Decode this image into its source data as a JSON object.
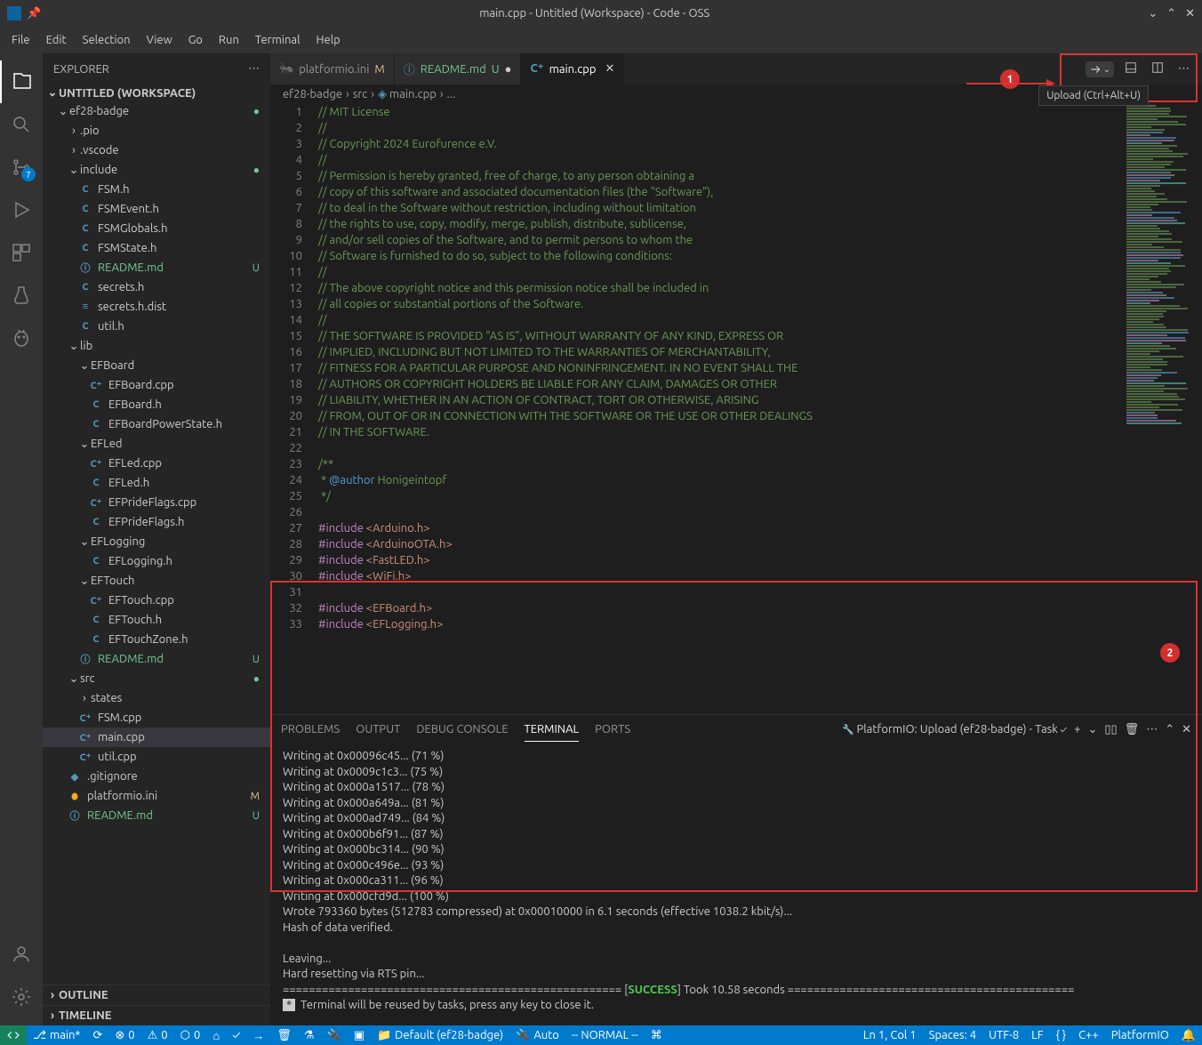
{
  "titlebar": {
    "title": "main.cpp - Untitled (Workspace) - Code - OSS"
  },
  "menubar": [
    "File",
    "Edit",
    "Selection",
    "View",
    "Go",
    "Run",
    "Terminal",
    "Help"
  ],
  "activitybar": {
    "items": [
      {
        "name": "explorer",
        "active": true
      },
      {
        "name": "search"
      },
      {
        "name": "source-control",
        "badge": "7"
      },
      {
        "name": "run-debug"
      },
      {
        "name": "extensions"
      },
      {
        "name": "testing"
      },
      {
        "name": "platformio"
      }
    ]
  },
  "sidebar": {
    "title": "EXPLORER",
    "workspace": "UNTITLED (WORKSPACE)",
    "tree": [
      {
        "l": 0,
        "t": "folder",
        "open": true,
        "name": "ef28-badge",
        "git": "dot"
      },
      {
        "l": 1,
        "t": "folder",
        "open": false,
        "name": ".pio"
      },
      {
        "l": 1,
        "t": "folder",
        "open": false,
        "name": ".vscode"
      },
      {
        "l": 1,
        "t": "folder",
        "open": true,
        "name": "include",
        "git": "dot"
      },
      {
        "l": 2,
        "t": "file",
        "icon": "C",
        "name": "FSM.h"
      },
      {
        "l": 2,
        "t": "file",
        "icon": "C",
        "name": "FSMEvent.h"
      },
      {
        "l": 2,
        "t": "file",
        "icon": "C",
        "name": "FSMGlobals.h"
      },
      {
        "l": 2,
        "t": "file",
        "icon": "C",
        "name": "FSMState.h"
      },
      {
        "l": 2,
        "t": "file",
        "icon": "i",
        "name": "README.md",
        "git": "U",
        "untracked": true
      },
      {
        "l": 2,
        "t": "file",
        "icon": "C",
        "name": "secrets.h"
      },
      {
        "l": 2,
        "t": "file",
        "icon": "≡",
        "name": "secrets.h.dist"
      },
      {
        "l": 2,
        "t": "file",
        "icon": "C",
        "name": "util.h"
      },
      {
        "l": 1,
        "t": "folder",
        "open": true,
        "name": "lib"
      },
      {
        "l": 2,
        "t": "folder",
        "open": true,
        "name": "EFBoard"
      },
      {
        "l": 3,
        "t": "file",
        "icon": "C⁺",
        "name": "EFBoard.cpp"
      },
      {
        "l": 3,
        "t": "file",
        "icon": "C",
        "name": "EFBoard.h"
      },
      {
        "l": 3,
        "t": "file",
        "icon": "C",
        "name": "EFBoardPowerState.h"
      },
      {
        "l": 2,
        "t": "folder",
        "open": true,
        "name": "EFLed"
      },
      {
        "l": 3,
        "t": "file",
        "icon": "C⁺",
        "name": "EFLed.cpp"
      },
      {
        "l": 3,
        "t": "file",
        "icon": "C",
        "name": "EFLed.h"
      },
      {
        "l": 3,
        "t": "file",
        "icon": "C⁺",
        "name": "EFPrideFlags.cpp"
      },
      {
        "l": 3,
        "t": "file",
        "icon": "C",
        "name": "EFPrideFlags.h"
      },
      {
        "l": 2,
        "t": "folder",
        "open": true,
        "name": "EFLogging"
      },
      {
        "l": 3,
        "t": "file",
        "icon": "C",
        "name": "EFLogging.h"
      },
      {
        "l": 2,
        "t": "folder",
        "open": true,
        "name": "EFTouch"
      },
      {
        "l": 3,
        "t": "file",
        "icon": "C⁺",
        "name": "EFTouch.cpp"
      },
      {
        "l": 3,
        "t": "file",
        "icon": "C",
        "name": "EFTouch.h"
      },
      {
        "l": 3,
        "t": "file",
        "icon": "C",
        "name": "EFTouchZone.h"
      },
      {
        "l": 2,
        "t": "file",
        "icon": "i",
        "name": "README.md",
        "git": "U",
        "untracked": true
      },
      {
        "l": 1,
        "t": "folder",
        "open": true,
        "name": "src",
        "git": "dot"
      },
      {
        "l": 2,
        "t": "folder",
        "open": false,
        "name": "states"
      },
      {
        "l": 2,
        "t": "file",
        "icon": "C⁺",
        "name": "FSM.cpp"
      },
      {
        "l": 2,
        "t": "file",
        "icon": "C⁺",
        "name": "main.cpp",
        "selected": true
      },
      {
        "l": 2,
        "t": "file",
        "icon": "C⁺",
        "name": "util.cpp"
      },
      {
        "l": 1,
        "t": "file",
        "icon": "◆",
        "name": ".gitignore"
      },
      {
        "l": 1,
        "t": "file",
        "icon": "pio",
        "name": "platformio.ini",
        "git": "M"
      },
      {
        "l": 1,
        "t": "file",
        "icon": "i",
        "name": "README.md",
        "git": "U",
        "untracked": true
      }
    ],
    "outline": "OUTLINE",
    "timeline": "TIMELINE"
  },
  "tabs": [
    {
      "icon": "pio",
      "name": "platformio.ini",
      "status": "M",
      "statusClass": "git-m"
    },
    {
      "icon": "i",
      "name": "README.md",
      "status": "U",
      "statusClass": "git-u",
      "dot": true
    },
    {
      "icon": "C⁺",
      "name": "main.cpp",
      "active": true,
      "close": true
    }
  ],
  "tooltip": "Upload (Ctrl+Alt+U)",
  "breadcrumb": [
    "ef28-badge",
    "src",
    "main.cpp",
    "..."
  ],
  "code": {
    "lines": [
      {
        "n": 1,
        "h": "<span class='c-comment'>// MIT License</span>"
      },
      {
        "n": 2,
        "h": "<span class='c-comment'>//</span>"
      },
      {
        "n": 3,
        "h": "<span class='c-comment'>// Copyright 2024 Eurofurence e.V.</span>"
      },
      {
        "n": 4,
        "h": "<span class='c-comment'>//</span>"
      },
      {
        "n": 5,
        "h": "<span class='c-comment'>// Permission is hereby granted, free of charge, to any person obtaining a</span>"
      },
      {
        "n": 6,
        "h": "<span class='c-comment'>// copy of this software and associated documentation files (the \"Software\"),</span>"
      },
      {
        "n": 7,
        "h": "<span class='c-comment'>// to deal in the Software without restriction, including without limitation</span>"
      },
      {
        "n": 8,
        "h": "<span class='c-comment'>// the rights to use, copy, modify, merge, publish, distribute, sublicense,</span>"
      },
      {
        "n": 9,
        "h": "<span class='c-comment'>// and/or sell copies of the Software, and to permit persons to whom the</span>"
      },
      {
        "n": 10,
        "h": "<span class='c-comment'>// Software is furnished to do so, subject to the following conditions:</span>"
      },
      {
        "n": 11,
        "h": "<span class='c-comment'>//</span>"
      },
      {
        "n": 12,
        "h": "<span class='c-comment'>// The above copyright notice and this permission notice shall be included in</span>"
      },
      {
        "n": 13,
        "h": "<span class='c-comment'>// all copies or substantial portions of the Software.</span>"
      },
      {
        "n": 14,
        "h": "<span class='c-comment'>//</span>"
      },
      {
        "n": 15,
        "h": "<span class='c-comment'>// THE SOFTWARE IS PROVIDED \"AS IS\", WITHOUT WARRANTY OF ANY KIND, EXPRESS OR</span>"
      },
      {
        "n": 16,
        "h": "<span class='c-comment'>// IMPLIED, INCLUDING BUT NOT LIMITED TO THE WARRANTIES OF MERCHANTABILITY,</span>"
      },
      {
        "n": 17,
        "h": "<span class='c-comment'>// FITNESS FOR A PARTICULAR PURPOSE AND NONINFRINGEMENT. IN NO EVENT SHALL THE</span>"
      },
      {
        "n": 18,
        "h": "<span class='c-comment'>// AUTHORS OR COPYRIGHT HOLDERS BE LIABLE FOR ANY CLAIM, DAMAGES OR OTHER</span>"
      },
      {
        "n": 19,
        "h": "<span class='c-comment'>// LIABILITY, WHETHER IN AN ACTION OF CONTRACT, TORT OR OTHERWISE, ARISING</span>"
      },
      {
        "n": 20,
        "h": "<span class='c-comment'>// FROM, OUT OF OR IN CONNECTION WITH THE SOFTWARE OR THE USE OR OTHER DEALINGS</span>"
      },
      {
        "n": 21,
        "h": "<span class='c-comment'>// IN THE SOFTWARE.</span>"
      },
      {
        "n": 22,
        "h": ""
      },
      {
        "n": 23,
        "h": "<span class='c-comment'>/**</span>"
      },
      {
        "n": 24,
        "h": "<span class='c-comment'> * </span><span class='c-annot'>@author</span><span class='c-comment'> Honigeintopf</span>"
      },
      {
        "n": 25,
        "h": "<span class='c-comment'> */</span>"
      },
      {
        "n": 26,
        "h": ""
      },
      {
        "n": 27,
        "h": "<span class='c-keyword'>#include</span> <span class='c-string'>&lt;Arduino.h&gt;</span>"
      },
      {
        "n": 28,
        "h": "<span class='c-keyword'>#include</span> <span class='c-string'>&lt;ArduinoOTA.h&gt;</span>"
      },
      {
        "n": 29,
        "h": "<span class='c-keyword'>#include</span> <span class='c-string'>&lt;FastLED.h&gt;</span>"
      },
      {
        "n": 30,
        "h": "<span class='c-keyword'>#include</span> <span class='c-string'>&lt;WiFi.h&gt;</span>"
      },
      {
        "n": 31,
        "h": ""
      },
      {
        "n": 32,
        "h": "<span class='c-keyword'>#include</span> <span class='c-string'>&lt;EFBoard.h&gt;</span>"
      },
      {
        "n": 33,
        "h": "<span class='c-keyword'>#include</span> <span class='c-string'>&lt;EFLogging.h&gt;</span>"
      }
    ]
  },
  "panel": {
    "tabs": [
      "PROBLEMS",
      "OUTPUT",
      "DEBUG CONSOLE",
      "TERMINAL",
      "PORTS"
    ],
    "active": 3,
    "task": "PlatformIO: Upload (ef28-badge) - Task",
    "terminal": [
      "Writing at 0x00096c45... (71 %)",
      "Writing at 0x0009c1c3... (75 %)",
      "Writing at 0x000a1517... (78 %)",
      "Writing at 0x000a649a... (81 %)",
      "Writing at 0x000ad749... (84 %)",
      "Writing at 0x000b6f91... (87 %)",
      "Writing at 0x000bc314... (90 %)",
      "Writing at 0x000c496e... (93 %)",
      "Writing at 0x000ca311... (96 %)",
      "Writing at 0x000cfd9d... (100 %)",
      "Wrote 793360 bytes (512783 compressed) at 0x00010000 in 6.1 seconds (effective 1038.2 kbit/s)...",
      "Hash of data verified.",
      "",
      "Leaving...",
      "Hard resetting via RTS pin..."
    ],
    "success_left": "==================================================== [",
    "success": "SUCCESS",
    "success_right": "] Took 10.58 seconds ============================================",
    "reuse": " *  Terminal will be reused by tasks, press any key to close it."
  },
  "statusbar": {
    "left": [
      {
        "icon": "branch",
        "text": "main*"
      },
      {
        "icon": "sync",
        "text": ""
      },
      {
        "icon": "error",
        "text": "0"
      },
      {
        "icon": "warn",
        "text": "0"
      },
      {
        "icon": "port",
        "text": "0"
      },
      {
        "icon": "home",
        "text": ""
      },
      {
        "icon": "check",
        "text": ""
      },
      {
        "icon": "arrow",
        "text": ""
      },
      {
        "icon": "trash",
        "text": ""
      },
      {
        "icon": "beaker",
        "text": ""
      },
      {
        "icon": "plug",
        "text": ""
      },
      {
        "icon": "terminal",
        "text": ""
      },
      {
        "icon": "folder",
        "text": "Default (ef28-badge)"
      },
      {
        "icon": "plug2",
        "text": "Auto"
      },
      {
        "text": "-- NORMAL --"
      },
      {
        "icon": "cmd",
        "text": ""
      }
    ],
    "right": [
      {
        "text": "Ln 1, Col 1"
      },
      {
        "text": "Spaces: 4"
      },
      {
        "text": "UTF-8"
      },
      {
        "text": "LF"
      },
      {
        "text": "{ }"
      },
      {
        "text": "C++"
      },
      {
        "text": "PlatformIO"
      },
      {
        "icon": "bell",
        "text": ""
      }
    ]
  },
  "annotations": {
    "badge1": "1",
    "badge2": "2"
  }
}
